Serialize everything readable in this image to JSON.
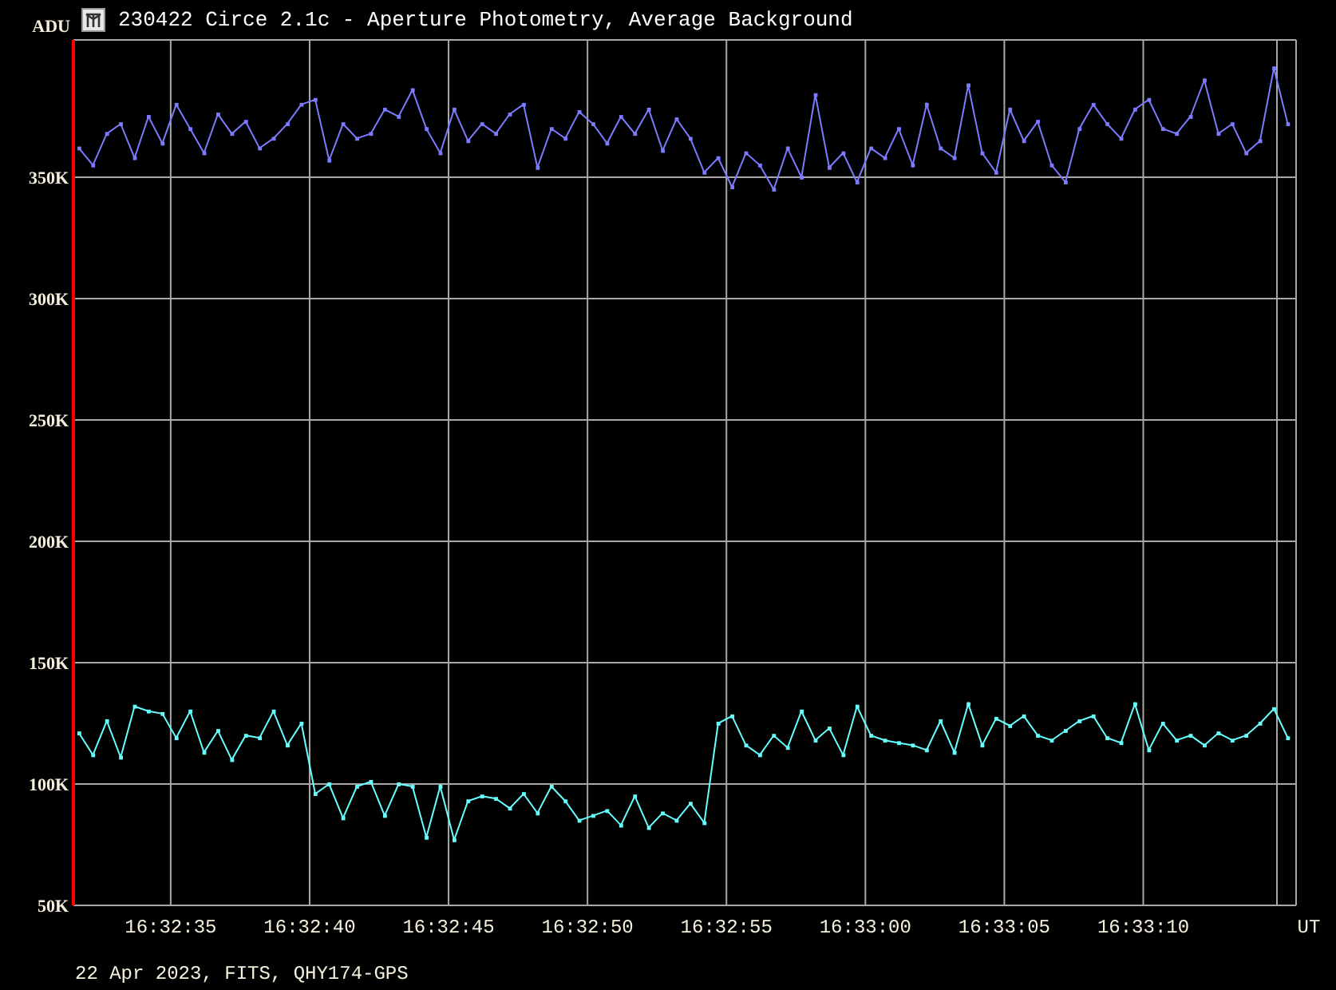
{
  "window": {
    "title": "230422 Circe 2.1c - Aperture Photometry, Average Background"
  },
  "chart_data": {
    "type": "line",
    "grid": true,
    "xlabel": "UT",
    "ylabel": "ADU",
    "xlim": [
      59551.5,
      59595.5
    ],
    "ylim": [
      50,
      406.6
    ],
    "xticks": [
      {
        "value": 59555,
        "label": "16:32:35"
      },
      {
        "value": 59560,
        "label": "16:32:40"
      },
      {
        "value": 59565,
        "label": "16:32:45"
      },
      {
        "value": 59570,
        "label": "16:32:50"
      },
      {
        "value": 59575,
        "label": "16:32:55"
      },
      {
        "value": 59580,
        "label": "16:33:00"
      },
      {
        "value": 59585,
        "label": "16:33:05"
      },
      {
        "value": 59590,
        "label": "16:33:10"
      }
    ],
    "yticks": [
      {
        "value": 50,
        "label": "50K"
      },
      {
        "value": 100,
        "label": "100K"
      },
      {
        "value": 150,
        "label": "150K"
      },
      {
        "value": 200,
        "label": "200K"
      },
      {
        "value": 250,
        "label": "250K"
      },
      {
        "value": 300,
        "label": "300K"
      },
      {
        "value": 350,
        "label": "350K"
      }
    ],
    "x": [
      59551.7,
      59552.2,
      59552.7,
      59553.2,
      59553.7,
      59554.2,
      59554.7,
      59555.2,
      59555.7,
      59556.2,
      59556.7,
      59557.2,
      59557.7,
      59558.2,
      59558.7,
      59559.2,
      59559.7,
      59560.2,
      59560.7,
      59561.2,
      59561.7,
      59562.2,
      59562.7,
      59563.2,
      59563.7,
      59564.2,
      59564.7,
      59565.2,
      59565.7,
      59566.2,
      59566.7,
      59567.2,
      59567.7,
      59568.2,
      59568.7,
      59569.2,
      59569.7,
      59570.2,
      59570.7,
      59571.2,
      59571.7,
      59572.2,
      59572.7,
      59573.2,
      59573.7,
      59574.2,
      59574.7,
      59575.2,
      59575.7,
      59576.2,
      59576.7,
      59577.2,
      59577.7,
      59578.2,
      59578.7,
      59579.2,
      59579.7,
      59580.2,
      59580.7,
      59581.2,
      59581.7,
      59582.2,
      59582.7,
      59583.2,
      59583.7,
      59584.2,
      59584.7,
      59585.2,
      59585.7,
      59586.2,
      59586.7,
      59587.2,
      59587.7,
      59588.2,
      59588.7,
      59589.2,
      59589.7,
      59590.2,
      59590.7,
      59591.2,
      59591.7,
      59592.2,
      59592.7,
      59593.2,
      59593.7,
      59594.2,
      59594.7,
      59595.2
    ],
    "series": [
      {
        "color": "#7b7bff",
        "marker": "square",
        "values": [
          362,
          355,
          368,
          372,
          358,
          375,
          364,
          380,
          370,
          360,
          376,
          368,
          373,
          362,
          366,
          372,
          380,
          382,
          357,
          372,
          366,
          368,
          378,
          375,
          386,
          370,
          360,
          378,
          365,
          372,
          368,
          376,
          380,
          354,
          370,
          366,
          377,
          372,
          364,
          375,
          368,
          378,
          361,
          374,
          366,
          352,
          358,
          346,
          360,
          355,
          345,
          362,
          350,
          384,
          354,
          360,
          348,
          362,
          358,
          370,
          355,
          380,
          362,
          358,
          388,
          360,
          352,
          378,
          365,
          373,
          355,
          348,
          370,
          380,
          372,
          366,
          378,
          382,
          370,
          368,
          375,
          390,
          368,
          372,
          360,
          365,
          395,
          372
        ]
      },
      {
        "color": "#66ffff",
        "marker": "square",
        "values": [
          121,
          112,
          126,
          111,
          132,
          130,
          129,
          119,
          130,
          113,
          122,
          110,
          120,
          119,
          130,
          116,
          125,
          96,
          100,
          86,
          99,
          101,
          87,
          100,
          99,
          78,
          99,
          77,
          93,
          95,
          94,
          90,
          96,
          88,
          99,
          93,
          85,
          87,
          89,
          83,
          95,
          82,
          88,
          85,
          92,
          84,
          125,
          128,
          116,
          112,
          120,
          115,
          130,
          118,
          123,
          112,
          132,
          120,
          118,
          117,
          116,
          114,
          126,
          113,
          133,
          116,
          127,
          124,
          128,
          120,
          118,
          122,
          126,
          128,
          119,
          117,
          133,
          114,
          125,
          118,
          120,
          116,
          121,
          118,
          120,
          125,
          131,
          119
        ]
      }
    ]
  },
  "status": "22 Apr 2023, FITS, QHY174-GPS"
}
